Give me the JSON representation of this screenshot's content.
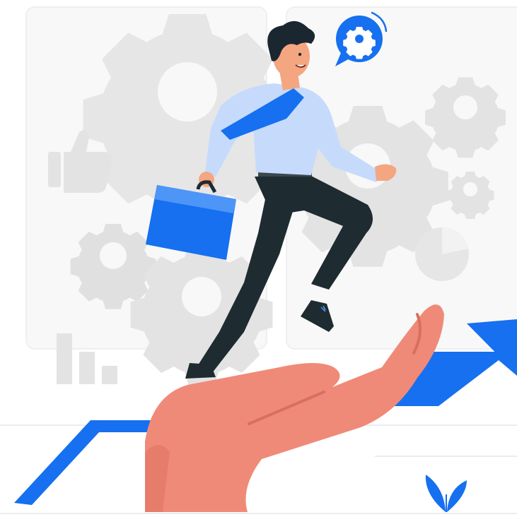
{
  "illustration": {
    "subject": "businessman-climbing-on-hand",
    "colors": {
      "accent": "#1670f0",
      "accent_light": "#4d95f7",
      "shirt": "#c6dafc",
      "shirt_shadow": "#a9c5f5",
      "pants": "#1e2b31",
      "hair": "#1b2730",
      "skin": "#f4a681",
      "hand": "#f08a78",
      "hand_shadow": "#d8705f",
      "panel": "#f7f7f7",
      "panel_border": "#ededed",
      "gear": "#e5e5e5",
      "gear_dark": "#dcdcdc",
      "floor_line": "#eaeaea"
    },
    "icons": [
      "gear-icon",
      "thumbs-up-icon",
      "bar-chart-icon",
      "pie-chart-icon",
      "speech-bubble-gear-icon",
      "growth-arrow-icon",
      "briefcase-icon",
      "leaf-icon"
    ]
  }
}
